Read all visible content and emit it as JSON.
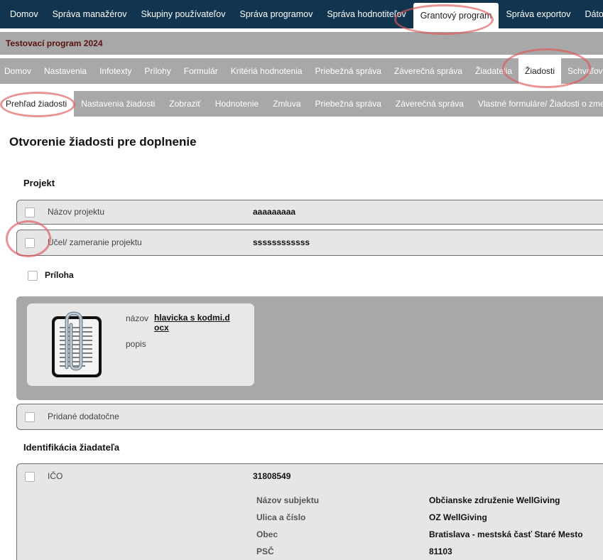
{
  "topnav": {
    "items": [
      "Domov",
      "Správa manažérov",
      "Skupiny používateľov",
      "Správa programov",
      "Správa hodnotiteľov",
      "Grantový program",
      "Správa exportov",
      "Dátové zd"
    ],
    "active_index": 5
  },
  "program": {
    "title": "Testovací program 2024"
  },
  "subnav": {
    "items": [
      "Domov",
      "Nastavenia",
      "Infotexty",
      "Prílohy",
      "Formulár",
      "Kritériá hodnotenia",
      "Priebežná správa",
      "Záverečná správa",
      "Žiadatelia",
      "Žiadosti",
      "Schvaľov"
    ],
    "active_index": 9
  },
  "thirdnav": {
    "items": [
      "Prehľad žiadosti",
      "Nastavenia žiadosti",
      "Zobraziť",
      "Hodnotenie",
      "Zmluva",
      "Priebežná správa",
      "Záverečná správa",
      "Vlastné formuláre/ Žiadosti o zme"
    ],
    "active_index": 0
  },
  "page": {
    "title": "Otvorenie žiadosti pre doplnenie"
  },
  "projekt": {
    "heading": "Projekt",
    "fields": [
      {
        "label": "Názov projektu",
        "value": "aaaaaaaaa"
      },
      {
        "label": "Účel/ zameranie projektu",
        "value": "ssssssssssss"
      }
    ],
    "priloha_label": "Príloha",
    "attachment": {
      "name_label": "názov",
      "name_value": "hlavicka s kodmi.docx",
      "desc_label": "popis",
      "icon": "document-clip-icon"
    },
    "added_label": "Pridané dodatočne"
  },
  "identifikacia": {
    "heading": "Identifikácia žiadateľa",
    "ico_label": "IČO",
    "ico_value": "31808549",
    "details": [
      {
        "label": "Názov subjektu",
        "value": "Občianske združenie WellGiving"
      },
      {
        "label": "Ulica a číslo",
        "value": "OZ WellGiving"
      },
      {
        "label": "Obec",
        "value": "Bratislava - mestská časť Staré Mesto"
      },
      {
        "label": "PSČ",
        "value": "81103"
      }
    ]
  },
  "colors": {
    "topnav_bg": "#11344f",
    "bar_bg": "#a8a8a8",
    "program_title": "#5a1212",
    "highlight": "#dc5a5a"
  }
}
